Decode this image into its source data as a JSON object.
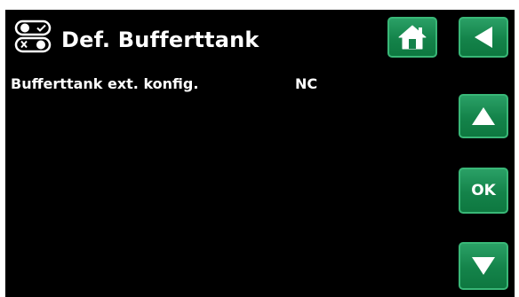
{
  "header": {
    "title": "Def. Bufferttank",
    "title_icon": "toggle-switches-icon"
  },
  "parameter": {
    "label": "Bufferttank ext. konfig.",
    "value": "NC"
  },
  "buttons": {
    "home_icon": "home-icon",
    "back_icon": "back-arrow-icon",
    "up_icon": "up-arrow-icon",
    "ok_label": "OK",
    "down_icon": "down-arrow-icon"
  },
  "colors": {
    "background": "#000000",
    "button_green": "#14834a",
    "text": "#ffffff"
  }
}
